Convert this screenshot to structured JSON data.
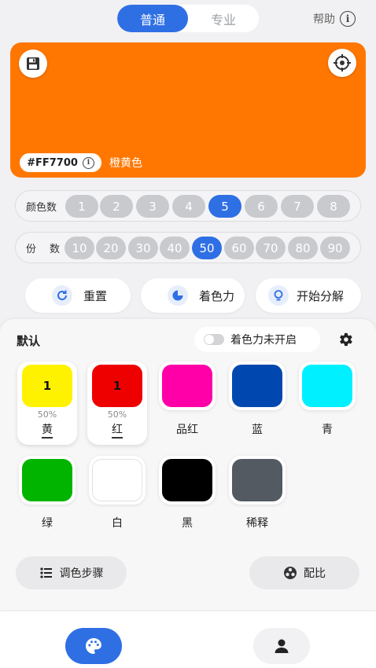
{
  "tabs": [
    {
      "label": "普通",
      "active": true
    },
    {
      "label": "专业",
      "active": false
    }
  ],
  "help": {
    "label": "帮助",
    "icon": "info-icon"
  },
  "color_panel": {
    "hex": "#FF7700",
    "name": "橙黄色",
    "color": "#ff7700"
  },
  "color_count": {
    "label": "颜色数",
    "options": [
      "1",
      "2",
      "3",
      "4",
      "5",
      "6",
      "7",
      "8"
    ],
    "selected": "5"
  },
  "portions": {
    "label": "份",
    "label2": "数",
    "options": [
      "10",
      "20",
      "30",
      "40",
      "50",
      "60",
      "70",
      "80",
      "90"
    ],
    "selected": "50"
  },
  "actions": {
    "reset": "重置",
    "tint": "着色力",
    "decompose": "开始分解"
  },
  "sheet": {
    "title": "默认",
    "toggle_label": "着色力未开启",
    "swatches": [
      {
        "name": "黄",
        "color": "#fff200",
        "count": "1",
        "percent": "50%",
        "selected": true
      },
      {
        "name": "红",
        "color": "#ee0000",
        "count": "1",
        "percent": "50%",
        "selected": true
      },
      {
        "name": "品红",
        "color": "#ff00a8",
        "selected": false
      },
      {
        "name": "蓝",
        "color": "#0048b0",
        "selected": false
      },
      {
        "name": "青",
        "color": "#00f0ff",
        "selected": false
      },
      {
        "name": "绿",
        "color": "#00b400",
        "selected": false
      },
      {
        "name": "白",
        "color": "#ffffff",
        "selected": false
      },
      {
        "name": "黑",
        "color": "#000000",
        "selected": false
      },
      {
        "name": "稀释",
        "color": "#535a61",
        "selected": false
      }
    ],
    "steps_button": "调色步骤",
    "ratio_button": "配比"
  },
  "nav": [
    {
      "icon": "palette-icon",
      "active": true
    },
    {
      "icon": "user-icon",
      "active": false
    }
  ],
  "colors": {
    "accent": "#2f6fe4",
    "chip_off": "#c9cacd"
  }
}
